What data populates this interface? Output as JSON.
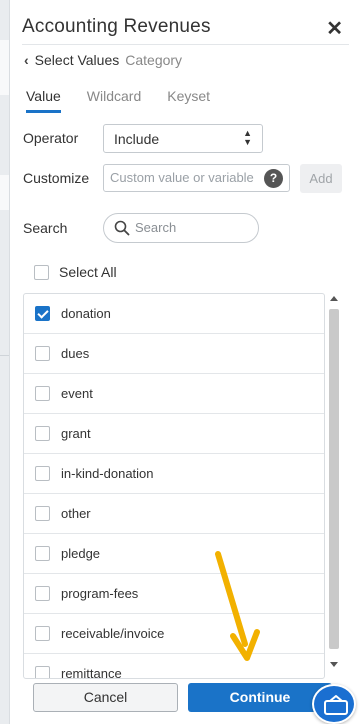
{
  "panel": {
    "title": "Accounting Revenues",
    "close_icon": "close-icon",
    "breadcrumb": {
      "label": "Select Values",
      "sublabel": "Category"
    }
  },
  "tabs": [
    {
      "label": "Value",
      "active": true
    },
    {
      "label": "Wildcard",
      "active": false
    },
    {
      "label": "Keyset",
      "active": false
    }
  ],
  "operator": {
    "label": "Operator",
    "value": "Include"
  },
  "customize": {
    "label": "Customize",
    "placeholder": "Custom value or variable (",
    "help": "?",
    "add_label": "Add"
  },
  "search": {
    "label": "Search",
    "placeholder": "Search"
  },
  "select_all": {
    "label": "Select All",
    "checked": false
  },
  "values": [
    {
      "label": "donation",
      "checked": true
    },
    {
      "label": "dues",
      "checked": false
    },
    {
      "label": "event",
      "checked": false
    },
    {
      "label": "grant",
      "checked": false
    },
    {
      "label": "in-kind-donation",
      "checked": false
    },
    {
      "label": "other",
      "checked": false
    },
    {
      "label": "pledge",
      "checked": false
    },
    {
      "label": "program-fees",
      "checked": false
    },
    {
      "label": "receivable/invoice",
      "checked": false
    },
    {
      "label": "remittance",
      "checked": false
    }
  ],
  "footer": {
    "cancel_label": "Cancel",
    "continue_label": "Continue"
  },
  "colors": {
    "accent": "#1a73c8",
    "annotation_arrow": "#f2b100"
  }
}
